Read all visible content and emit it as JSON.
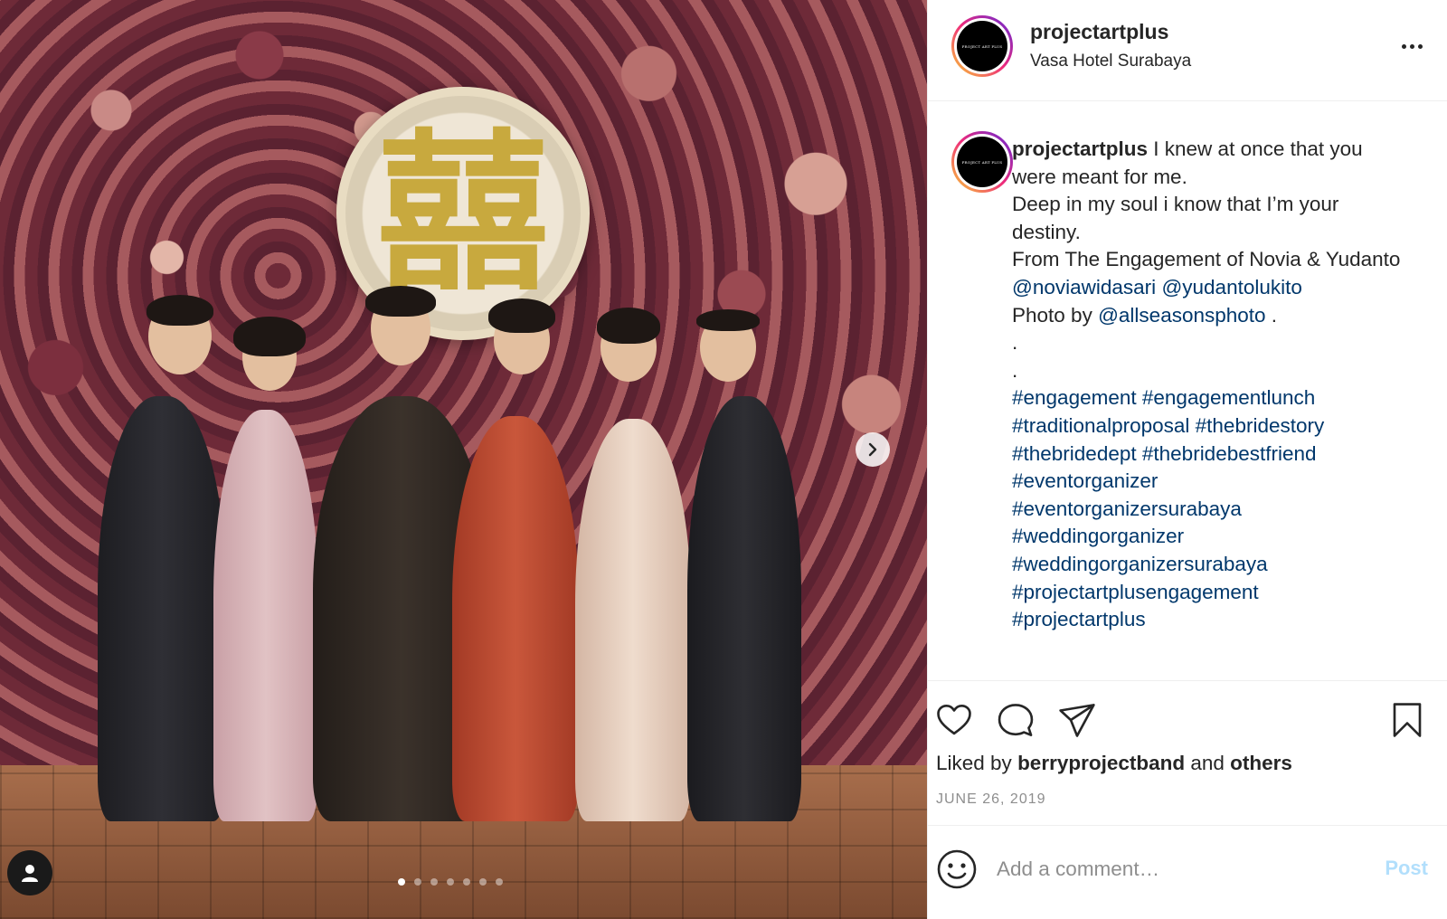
{
  "post": {
    "username": "projectartplus",
    "location": "Vasa Hotel Surabaya",
    "avatar_text": "PROJECT ART PLUS",
    "carousel": {
      "slide_count": 7,
      "current_index": 0
    }
  },
  "caption": {
    "username": "projectartplus",
    "text_1": " I knew at once that you were meant for me.",
    "text_2": "Deep in my soul i know that I’m your destiny.",
    "text_3": "From The Engagement of Novia & Yudanto",
    "mention_1": "@noviawidasari",
    "mention_2": "@yudantolukito",
    "photo_by": "Photo by ",
    "mention_3": "@allseasonsphoto",
    "photo_by_end": " .",
    "dot_1": ".",
    "dot_2": ".",
    "hashtags": [
      "#engagement",
      "#engagementlunch",
      "#traditionalproposal",
      "#thebridestory",
      "#thebridedept",
      "#thebridebestfriend",
      "#eventorganizer",
      "#eventorganizersurabaya",
      "#weddingorganizer",
      "#weddingorganizersurabaya",
      "#projectartplusengagement",
      "#projectartplus"
    ]
  },
  "likes": {
    "prefix": "Liked by ",
    "user": "berryprojectband",
    "middle": " and ",
    "others": "others"
  },
  "date": "JUNE 26, 2019",
  "comment": {
    "placeholder": "Add a comment…",
    "post_label": "Post"
  },
  "icons": {
    "like": "heart-icon",
    "comment": "speech-bubble-icon",
    "share": "paper-plane-icon",
    "save": "bookmark-icon",
    "emoji": "smiley-icon",
    "more": "ellipsis-icon",
    "next": "chevron-right-icon",
    "tags": "user-icon"
  },
  "colors": {
    "link": "#00376b",
    "post_disabled": "#b2dffc",
    "muted": "#8e8e8e"
  }
}
